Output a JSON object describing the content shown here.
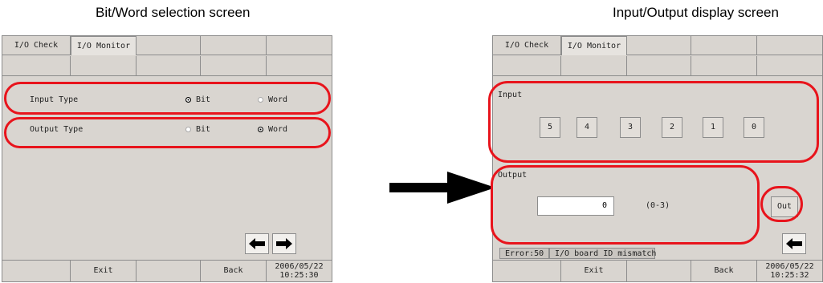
{
  "captions": {
    "left": "Bit/Word selection screen",
    "right": "Input/Output display screen"
  },
  "left_screen": {
    "tabs": [
      "I/O Check",
      "I/O Monitor"
    ],
    "input_type": {
      "label": "Input Type",
      "options": [
        "Bit",
        "Word"
      ],
      "selected": "Bit"
    },
    "output_type": {
      "label": "Output Type",
      "options": [
        "Bit",
        "Word"
      ],
      "selected": "Word"
    },
    "bottom": {
      "exit": "Exit",
      "back": "Back",
      "date": "2006/05/22",
      "time": "10:25:30"
    }
  },
  "right_screen": {
    "tabs": [
      "I/O Check",
      "I/O Monitor"
    ],
    "input_label": "Input",
    "input_bits": [
      "5",
      "4",
      "3",
      "2",
      "1",
      "0"
    ],
    "output_label": "Output",
    "output_value": "0",
    "output_range": "(0-3)",
    "out_button": "Out",
    "status": {
      "error": "Error:50",
      "message": "I/O board ID mismatch"
    },
    "bottom": {
      "exit": "Exit",
      "back": "Back",
      "date": "2006/05/22",
      "time": "10:25:32"
    }
  },
  "icons": {
    "left_arrow": "arrow-left-icon",
    "right_arrow": "arrow-right-icon",
    "transition_arrow": "arrow-right-icon"
  },
  "colors": {
    "highlight": "#e8141c",
    "panel": "#d9d5d0"
  }
}
